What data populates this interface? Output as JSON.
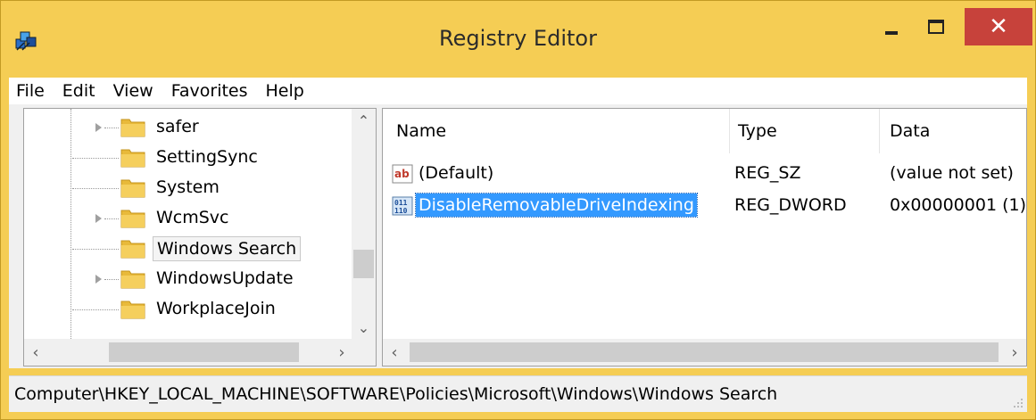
{
  "window": {
    "title": "Registry Editor",
    "close_symbol": "✕"
  },
  "menu": [
    {
      "label": "File"
    },
    {
      "label": "Edit"
    },
    {
      "label": "View"
    },
    {
      "label": "Favorites"
    },
    {
      "label": "Help"
    }
  ],
  "tree": {
    "items": [
      {
        "label": "safer",
        "expandable": true,
        "selected": false
      },
      {
        "label": "SettingSync",
        "expandable": false,
        "selected": false
      },
      {
        "label": "System",
        "expandable": false,
        "selected": false
      },
      {
        "label": "WcmSvc",
        "expandable": true,
        "selected": false
      },
      {
        "label": "Windows Search",
        "expandable": false,
        "selected": true
      },
      {
        "label": "WindowsUpdate",
        "expandable": true,
        "selected": false
      },
      {
        "label": "WorkplaceJoin",
        "expandable": false,
        "selected": false
      }
    ]
  },
  "list": {
    "columns": [
      "Name",
      "Type",
      "Data"
    ],
    "rows": [
      {
        "name": "(Default)",
        "type": "REG_SZ",
        "data": "(value not set)",
        "icon": "string-value-icon",
        "selected": false
      },
      {
        "name": "DisableRemovableDriveIndexing",
        "type": "REG_DWORD",
        "data": "0x00000001 (1)",
        "icon": "binary-value-icon",
        "selected": true
      }
    ]
  },
  "status": {
    "path": "Computer\\HKEY_LOCAL_MACHINE\\SOFTWARE\\Policies\\Microsoft\\Windows\\Windows Search"
  },
  "colors": {
    "frame": "#f5cd54",
    "close_button": "#c7423b",
    "selection": "#3399ff",
    "folder": "#e8b93a"
  }
}
